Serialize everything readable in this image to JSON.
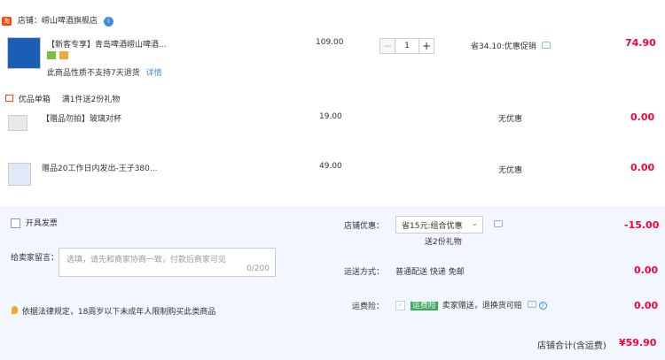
{
  "shop": {
    "icon": "淘",
    "name": "店铺：崂山啤酒旗舰店",
    "badge": "i"
  },
  "item": {
    "title": "【新客专享】青岛啤酒崂山啤酒...",
    "note": "此商品性质不支持7天退货",
    "detail_link": "详情",
    "price": "109.00",
    "qty": "1",
    "discount": "省34.10:优惠促销",
    "total": "74.90"
  },
  "gift_header": {
    "label": "优品单箱",
    "promo": "满1件送2份礼物"
  },
  "gifts": [
    {
      "title": "【赠品勿拍】玻璃对杯",
      "price": "19.00",
      "discount": "无优惠",
      "total": "0.00"
    },
    {
      "title": "赠品20工作日内发出-王子380...",
      "price": "49.00",
      "discount": "无优惠",
      "total": "0.00"
    }
  ],
  "invoice": {
    "label": "开具发票"
  },
  "message": {
    "label": "给卖家留言：",
    "placeholder": "选填，请先和商家协商一致，付款后商家可见",
    "counter": "0/200"
  },
  "legal": "依据法律规定，18周岁以下未成年人限制购买此类商品",
  "shop_discount": {
    "label": "店铺优惠：",
    "select_value": "省15元:组合优惠",
    "gift_note": "送2份礼物",
    "amount": "-15.00"
  },
  "shipping": {
    "label": "运送方式：",
    "value": "普通配送 快递 免邮",
    "amount": "0.00"
  },
  "insurance": {
    "label": "运费险：",
    "tag": "运费险",
    "value": "卖家赠送，退换货可赔",
    "amount": "0.00"
  },
  "summary": {
    "label": "店铺合计(含运费)",
    "total": "¥59.90"
  },
  "colors": {
    "accent": "#ff0036",
    "link": "#3c8ddc",
    "bottom_bg": "#f2f7ff"
  }
}
